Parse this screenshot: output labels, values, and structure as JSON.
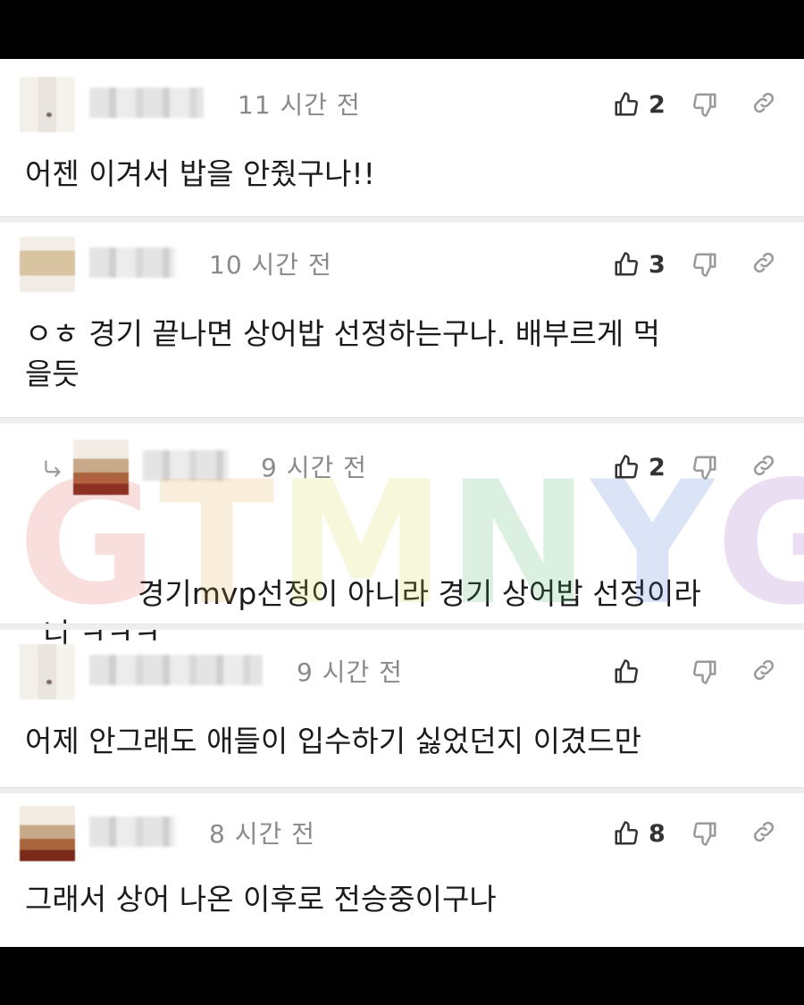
{
  "colors": {
    "text": "#1b1b1b",
    "time": "#8a8a8a",
    "icon": "#555555",
    "icon_muted": "#9a9a9a"
  },
  "comments": [
    {
      "time": "11 시간 전",
      "likes": "2",
      "text": "어젠 이겨서 밥을 안줬구나!!"
    },
    {
      "time": "10 시간 전",
      "likes": "3",
      "text_line1": "ㅇㅎ 경기 끝나면 상어밥 선정하는구나. 배부르게 먹",
      "text_line2": "을듯"
    },
    {
      "time": "9 시간 전",
      "likes": "2",
      "text_line1": "경기mvp선정이 아니라 경기 상어밥 선정이라",
      "text_line2": "니 ㅋㅋㅋ"
    },
    {
      "time": "9 시간 전",
      "likes": "",
      "text": "어제 안그래도 애들이 입수하기 싫었던지 이겼드만"
    },
    {
      "time": "8 시간 전",
      "likes": "8",
      "text": "그래서 상어 나온 이후로 전승중이구나"
    }
  ],
  "watermark": {
    "letters": [
      "G",
      "T",
      "M",
      "N",
      "Y",
      "G"
    ],
    "colors": [
      "#e05050",
      "#e0a040",
      "#d8d840",
      "#40b060",
      "#4070d0",
      "#9050c0"
    ]
  },
  "icons": {
    "like": "thumbs-up-icon",
    "dislike": "thumbs-down-icon",
    "link": "link-icon",
    "reply": "reply-arrow-icon"
  }
}
